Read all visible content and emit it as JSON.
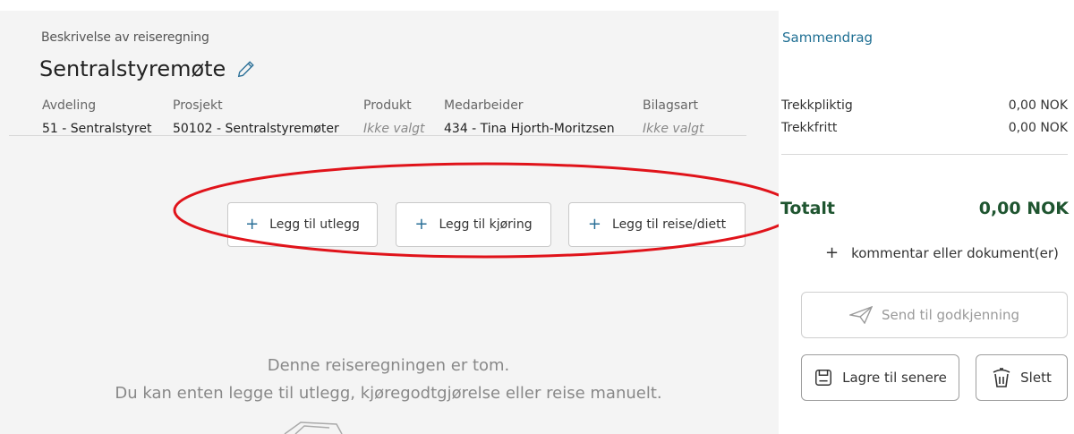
{
  "report": {
    "description_label": "Beskrivelse av reiseregning",
    "title": "Sentralstyremøte",
    "fields": [
      {
        "label": "Avdeling",
        "value": "51 - Sentralstyret"
      },
      {
        "label": "Prosjekt",
        "value": "50102 - Sentralstyremøter"
      },
      {
        "label": "Produkt",
        "value": "Ikke valgt"
      },
      {
        "label": "Medarbeider",
        "value": "434 - Tina Hjorth-Moritzsen"
      },
      {
        "label": "Bilagsart",
        "value": "Ikke valgt"
      }
    ]
  },
  "actions": {
    "add_expense": "Legg til utlegg",
    "add_driving": "Legg til kjøring",
    "add_travel": "Legg til reise/diett"
  },
  "empty_state": {
    "line1": "Denne reiseregningen er tom.",
    "line2": "Du kan enten legge til utlegg, kjøregodtgjørelse eller reise manuelt."
  },
  "summary": {
    "title": "Sammendrag",
    "taxable_label": "Trekkpliktig",
    "taxable_value": "0,00 NOK",
    "taxfree_label": "Trekkfritt",
    "taxfree_value": "0,00 NOK",
    "total_label": "Totalt",
    "total_value": "0,00 NOK",
    "comment_label": "kommentar eller dokument(er)",
    "send_label": "Send til godkjenning",
    "save_label": "Lagre til senere",
    "delete_label": "Slett"
  },
  "colors": {
    "accent": "#1f6f93",
    "total": "#1f5530",
    "annotation": "#e0131a"
  }
}
